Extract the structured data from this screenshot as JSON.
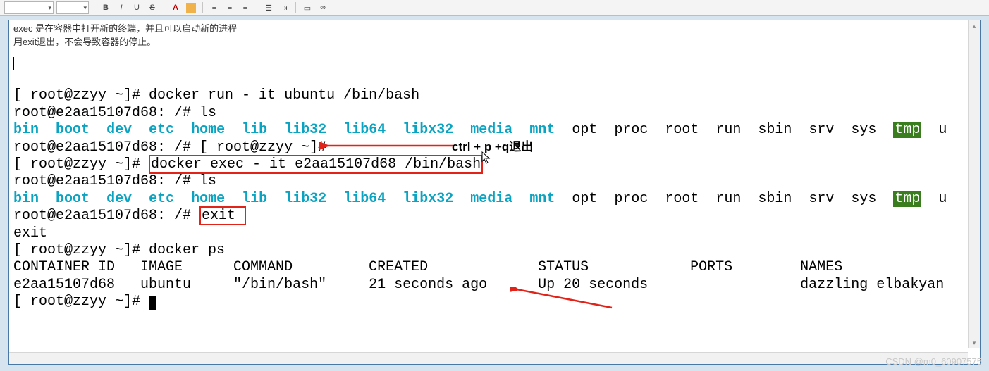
{
  "notes": {
    "line1": "exec 是在容器中打开新的终端，并且可以启动新的进程",
    "line2": "用exit退出，不会导致容器的停止。"
  },
  "annotation": {
    "ctrlpq": "ctrl + p +q退出"
  },
  "prompts": {
    "host": "[ root@zzyy ~]# ",
    "ctr": "root@e2aa15107d68: /# "
  },
  "cmds": {
    "run": "docker run - it ubuntu /bin/bash",
    "ls": "ls",
    "exec": "docker exec - it e2aa15107d68 /bin/bash",
    "exit": "exit",
    "ps": "docker ps"
  },
  "dirs": [
    "bin",
    "boot",
    "dev",
    "etc",
    "home",
    "lib",
    "lib32",
    "lib64",
    "libx32",
    "media",
    "mnt",
    "opt",
    "proc",
    "root",
    "run",
    "sbin",
    "srv",
    "sys",
    "tmp"
  ],
  "ps_header": {
    "id": "CONTAINER ID",
    "image": "IMAGE",
    "command": "COMMAND",
    "created": "CREATED",
    "status": "STATUS",
    "ports": "PORTS",
    "names": "NAMES"
  },
  "ps_row": {
    "id": "e2aa15107d68",
    "image": "ubuntu",
    "command": "\"/bin/bash\"",
    "created": "21 seconds ago",
    "status": "Up 20 seconds",
    "ports": "",
    "names": "dazzling_elbakyan"
  },
  "tail_u": "u",
  "watermark": "CSDN @m0_60907575"
}
